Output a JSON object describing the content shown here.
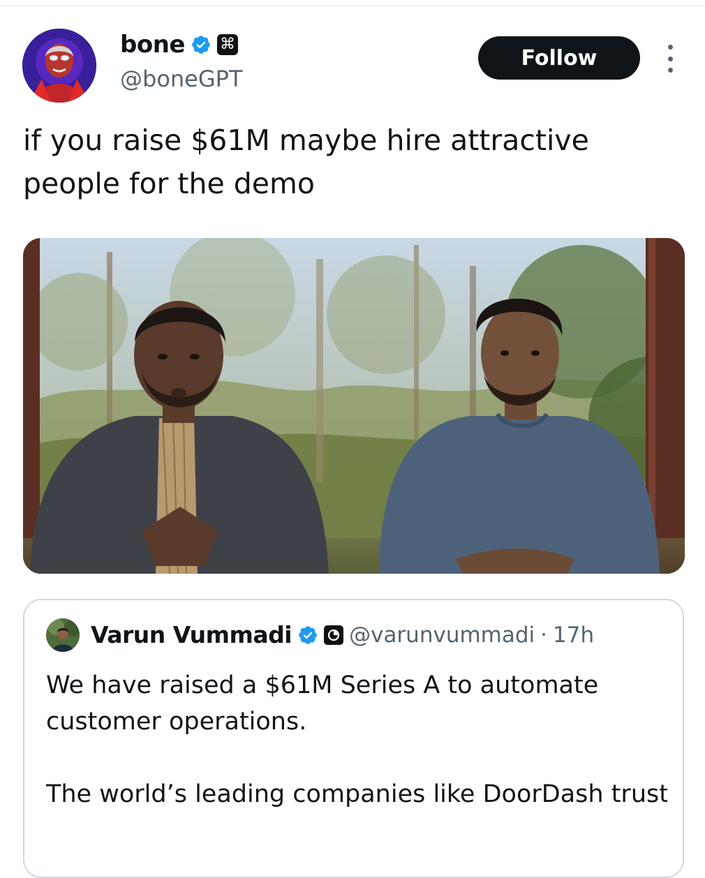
{
  "author": {
    "display_name": "bone",
    "handle": "@boneGPT",
    "verified_icon": "verified-badge-icon",
    "affiliation_icon": "command-key-icon",
    "affiliation_glyph": "⌘"
  },
  "actions": {
    "follow_label": "Follow",
    "more_icon": "more-vertical-icon"
  },
  "tweet": {
    "text": "if you raise $61M maybe hire attractive people for the demo"
  },
  "media": {
    "type": "video-still",
    "subject": "two-men-seated-in-front-of-window-with-trees"
  },
  "quoted_tweet": {
    "display_name": "Varun Vummadi",
    "handle": "@varunvummadi",
    "separator": "·",
    "time": "17h",
    "verified_icon": "verified-badge-icon",
    "affiliation_icon": "giga-logo-icon",
    "text_1": "We have raised a $61M Series A to automate customer operations.",
    "text_2": "The world’s leading companies like DoorDash trust Giga to supercharge customer experience ..."
  },
  "colors": {
    "text_primary": "#0f1419",
    "text_secondary": "#536471",
    "verified_blue": "#1d9bf0",
    "button_bg": "#0f1419",
    "border": "#cfd9de"
  }
}
